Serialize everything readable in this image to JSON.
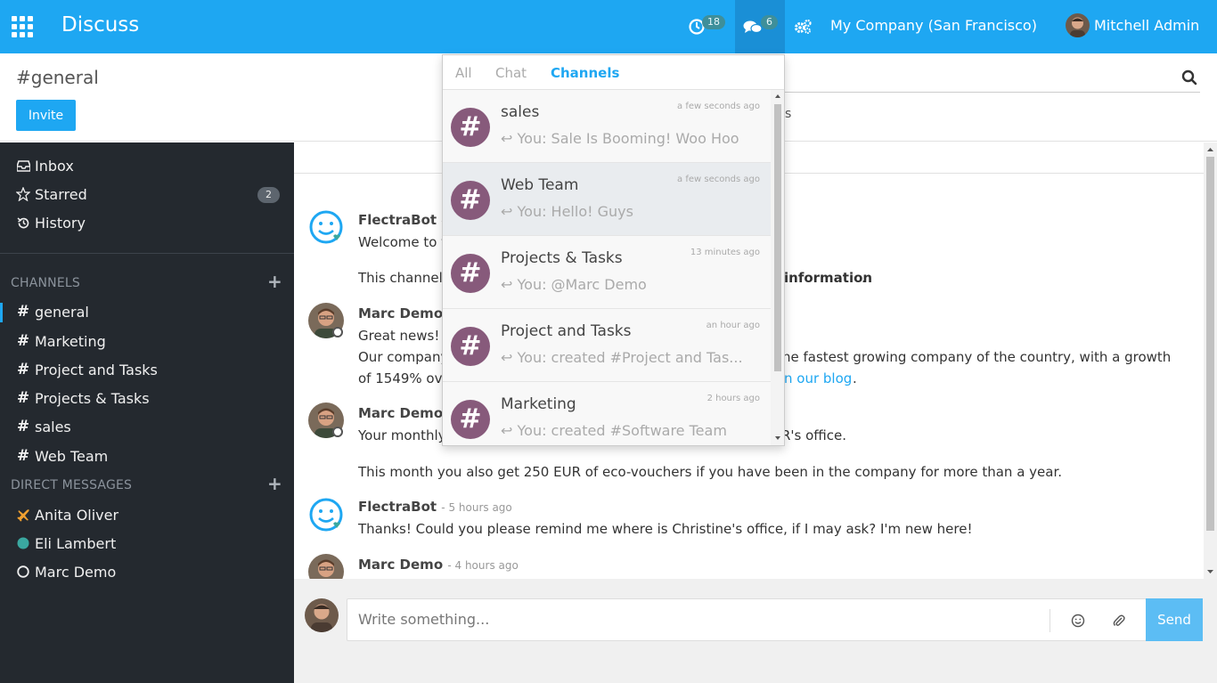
{
  "navbar": {
    "app_name": "Discuss",
    "activity_count": "18",
    "messages_count": "6",
    "company": "My Company (San Francisco)",
    "user": "Mitchell Admin",
    "colors": {
      "bar": "#1ea7f2",
      "badge": "#3e8f9a"
    }
  },
  "control": {
    "title": "#general",
    "invite_label": "Invite",
    "search_suffix": "s"
  },
  "sidebar": {
    "mailboxes": [
      {
        "label": "Inbox",
        "icon": "inbox-icon"
      },
      {
        "label": "Starred",
        "icon": "star-icon",
        "count": "2"
      },
      {
        "label": "History",
        "icon": "history-icon"
      }
    ],
    "channels_header": "CHANNELS",
    "channels": [
      "general",
      "Marketing",
      "Project and Tasks",
      "Projects & Tasks",
      "sales",
      "Web Team"
    ],
    "dm_header": "DIRECT MESSAGES",
    "direct_messages": [
      {
        "label": "Anita Oliver",
        "icon": "plane-icon"
      },
      {
        "label": "Eli Lambert",
        "icon": "online-dot-icon"
      },
      {
        "label": "Marc Demo",
        "icon": "offline-circle-icon"
      }
    ]
  },
  "thread": {
    "messages": [
      {
        "author": "FlectraBot",
        "date": "-",
        "lines": [
          "Welcome to t"
        ]
      },
      {
        "author": "",
        "date": "",
        "lines": [
          "This channel",
          "information",
          "."
        ]
      },
      {
        "author": "Marc Demo",
        "date": "",
        "lines": [
          "Great news!",
          "Our company",
          "he fastest growing company of the country, with a growth",
          "of 1549% ove",
          "n our blog",
          "."
        ]
      },
      {
        "author": "Marc Demo",
        "date": "",
        "lines": [
          "Your monthly",
          "R's office.",
          "This month you also get 250 EUR of eco-vouchers if you have been in the company for more than a year."
        ]
      },
      {
        "author": "FlectraBot",
        "date": "- 5 hours ago",
        "lines": [
          "Thanks! Could you please remind me where is Christine's office, if I may ask? I'm new here!"
        ]
      },
      {
        "author": "Marc Demo",
        "date": "- 4 hours ago",
        "lines": []
      }
    ]
  },
  "composer": {
    "placeholder": "Write something...",
    "send_label": "Send"
  },
  "dropdown": {
    "tabs": [
      "All",
      "Chat",
      "Channels"
    ],
    "active_tab": "Channels",
    "items": [
      {
        "name": "sales",
        "time": "a few seconds ago",
        "preview": "You: Sale Is Booming! Woo Hoo"
      },
      {
        "name": "Web Team",
        "time": "a few seconds ago",
        "preview": "You: Hello! Guys"
      },
      {
        "name": "Projects & Tasks",
        "time": "13 minutes ago",
        "preview": "You: @Marc Demo"
      },
      {
        "name": "Project and Tasks",
        "time": "an hour ago",
        "preview": "You: created #Project and Tas..."
      },
      {
        "name": "Marketing",
        "time": "2 hours ago",
        "preview": "You: created #Software Team"
      }
    ],
    "icon_color": "#875a7b"
  }
}
